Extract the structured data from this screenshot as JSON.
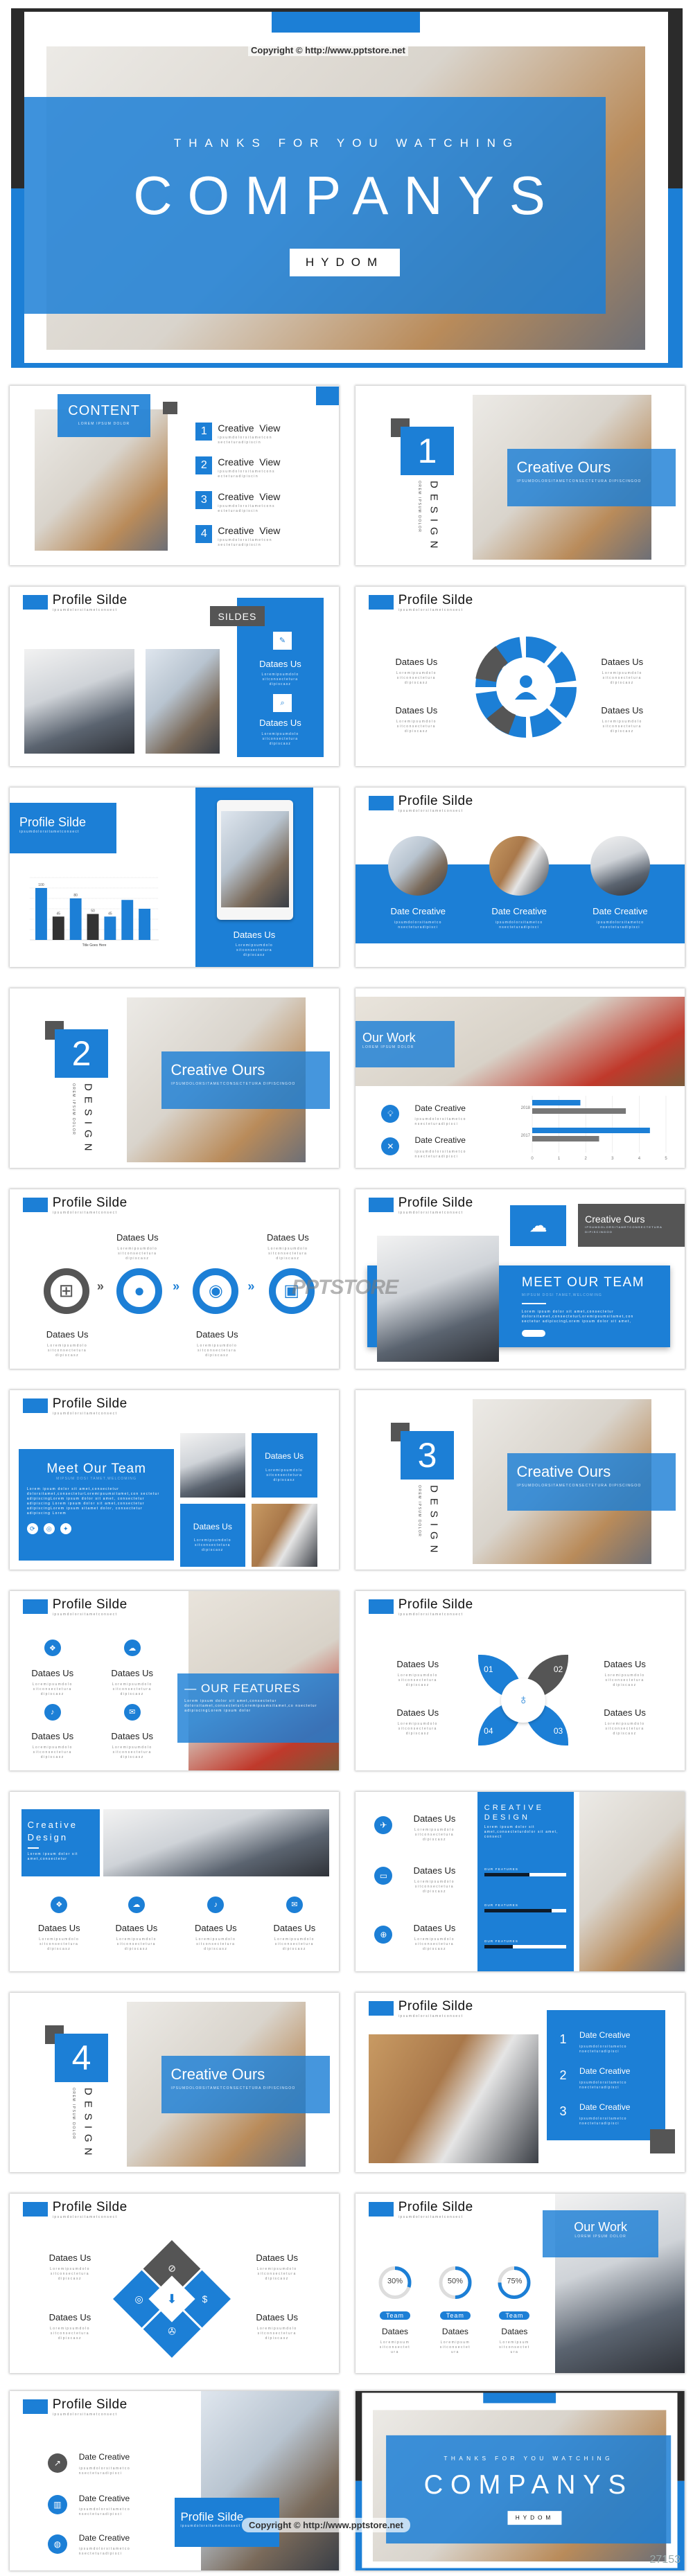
{
  "hero": {
    "copyright": "Copyright © http://www.pptstore.net",
    "tagline": "THANKS FOR YOU WATCHING",
    "title": "COMPANYS",
    "badge": "HYDOM"
  },
  "c": {
    "profile_title": "Profile Silde",
    "profile_sub": "ipsumdolorsitametconsect",
    "dataes": "Dataes Us",
    "dataes_desc": "Loremipsumdolo sitconsectetura dipiscasz",
    "date_creative": "Date Creative",
    "date_desc": "ipsumdolorsitametco nsecteturadipisci",
    "creative_ours": "Creative Ours",
    "creative_ours_sub": "IPSUMDOLORSITAMETCONSECTETURA DIPISCINGOO",
    "design": "DESIGN",
    "design_sub": "OREM IPSUM DOLOR",
    "accent_color": "#1c7fd6",
    "dark_color": "#555555"
  },
  "content_slide": {
    "title": "CONTENT",
    "sub": "LOREM IPSUM DOLOR",
    "items": [
      {
        "num": "1",
        "label": "Creative  View",
        "desc": "ipsumdolorsitametcon secteturadipiscin"
      },
      {
        "num": "2",
        "label": "Creative  View",
        "desc": "ipsumdolorsitametcons ecteturadipiscin"
      },
      {
        "num": "3",
        "label": "Creative  View",
        "desc": "ipsumdolorsitametcons ecteturadipiscin"
      },
      {
        "num": "4",
        "label": "Creative  View",
        "desc": "ipsumdolorsitametcon secteturadipiscin"
      }
    ]
  },
  "sections": [
    "1",
    "2",
    "3",
    "4"
  ],
  "sildes_tag": "SILDES",
  "chart_title": "Title Goes Here",
  "our_work": {
    "title": "Our Work",
    "sub": "LOREM IPSUM DOLOR"
  },
  "meet_team": {
    "title_caps": "MEET OUR TEAM",
    "title": "Meet Our Team",
    "sub": "MIPSUM DOSI TAMET,WELCOMING",
    "para_short": "Lorem ipsum dolor sit amet,consectetur dolorsitamet,consecteturLoremipsumsitamet,con sectetur adipiscingLorem ipsum dolor sit amet,",
    "para_long": "Lorem ipsum dolor sit amet,consectetur dolorsitamet,consecteturLoremipsumsitamet,con sectetur adipiscingLorem ipsum dolor sit amet, consectetur adipiscing Lorem ipsum dolor sit amet,consectetur adipiscingLorem ipsum sitamet dolor, consectetur adipiscing Lorem"
  },
  "features": {
    "title": "— OUR FEATURES",
    "para": "Lorem ipsum dolor sit amet,consectetur dolorsitamet,consecteturLoremipsumsitamet,co nsectetur adipiscingLorem ipsum dolor"
  },
  "petals": [
    "01",
    "02",
    "03",
    "04"
  ],
  "creative_design_box": {
    "title": "Creative Design",
    "para": "Lorem ipsum dolor sit amet,consectetur"
  },
  "creative_design_col": {
    "title": "CREATIVE DESIGN",
    "para": "Lorem ipsum dolor sit amet,consecteturdolor sit amet, consect",
    "bars": [
      {
        "label": "OUR FEATURES",
        "value": 0.55
      },
      {
        "label": "OUR FEATURES",
        "value": 0.82
      },
      {
        "label": "OUR FEATURES",
        "value": 0.35
      }
    ]
  },
  "numbered_list": [
    "1",
    "2",
    "3"
  ],
  "donuts": [
    {
      "value": "30%",
      "pct": 30,
      "pill": "Team",
      "label": "Dataes",
      "desc": "Loremipsum sitconsectet ura"
    },
    {
      "value": "50%",
      "pct": 50,
      "pill": "Team",
      "label": "Dataes",
      "desc": "Loremipsum sitconsectet ura"
    },
    {
      "value": "75%",
      "pct": 75,
      "pill": "Team",
      "label": "Dataes",
      "desc": "Loremipsum sitconsectet ura"
    }
  ],
  "watermark": "PPTSTORE",
  "image_id": "27153",
  "chart_data": [
    {
      "type": "bar",
      "title": "",
      "xlabel": "Title Goes Here",
      "ylim": [
        0,
        120
      ],
      "grid": true,
      "values": [
        100,
        45,
        80,
        50,
        45,
        77,
        60
      ],
      "data_labels": [
        "100",
        "45",
        "80",
        "50",
        "45",
        "",
        ""
      ],
      "colors": [
        "#1c7fd6",
        "#333333",
        "#1c7fd6",
        "#333333",
        "#1c7fd6",
        "#1c7fd6",
        "#1c7fd6"
      ]
    },
    {
      "type": "bar",
      "orientation": "horizontal",
      "categories": [
        "2018",
        "2017"
      ],
      "series": [
        {
          "values": [
            1.8,
            4.4
          ],
          "color": "#1c7fd6"
        },
        {
          "values": [
            3.5,
            2.5
          ],
          "color": "#777777"
        }
      ],
      "xlim": [
        0,
        5
      ],
      "xticks": [
        "0",
        "1",
        "2",
        "3",
        "4",
        "5"
      ]
    }
  ]
}
